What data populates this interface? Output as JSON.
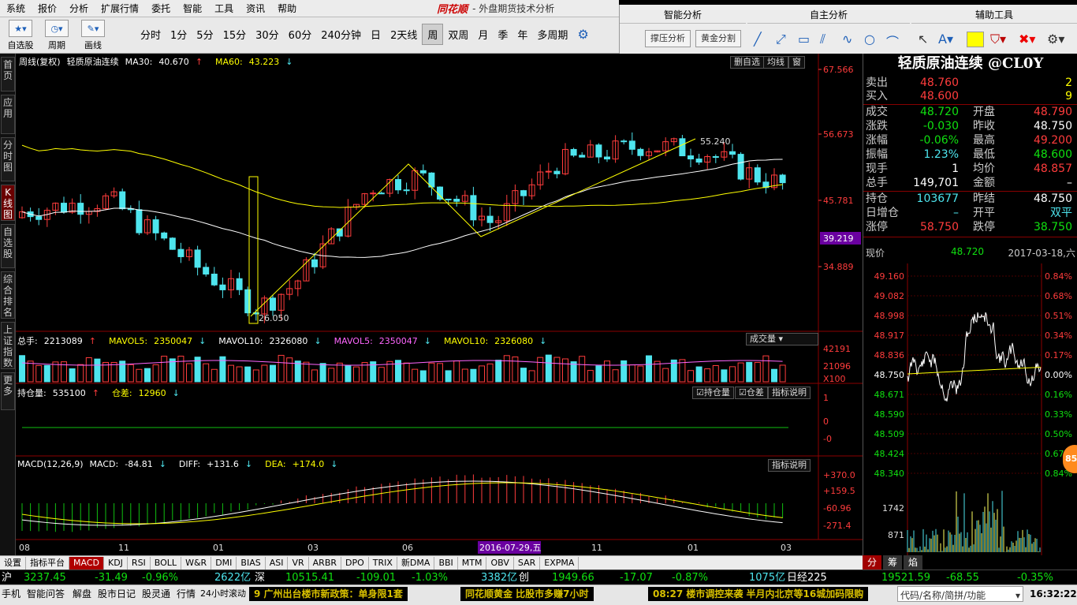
{
  "menu": [
    "系统",
    "报价",
    "分析",
    "扩展行情",
    "委托",
    "智能",
    "工具",
    "资讯",
    "帮助"
  ],
  "brand": "同花顺",
  "app_title": "- 外盘期货技术分析",
  "toolbar": {
    "zixuan": "自选股",
    "zhouqi": "周期",
    "huaxian": "画线"
  },
  "periods": [
    "分时",
    "1分",
    "5分",
    "15分",
    "30分",
    "60分",
    "240分钟",
    "日",
    "2天线",
    "周",
    "双周",
    "月",
    "季",
    "年",
    "多周期"
  ],
  "active_period": "周",
  "right_tools": {
    "tabs": [
      "智能分析",
      "自主分析",
      "辅助工具"
    ],
    "btn_support": "撑压分析",
    "btn_gold": "黄金分割"
  },
  "sidebar_tabs": [
    "首页",
    "应用",
    "分时图",
    "K线图",
    "自选股",
    "综合排名",
    "上证指数",
    "更多"
  ],
  "sidebar_active": "K线图",
  "kline": {
    "legend_prefix": "周线(复权)",
    "symbol_name": "轻质原油连续",
    "ma30_label": "MA30:",
    "ma30_value": "40.670",
    "ma60_label": "MA60:",
    "ma60_value": "43.223",
    "btn_delete": "删自选",
    "btn_ma": "均线",
    "btn_window": "窗",
    "price_ticks": [
      "67.566",
      "56.673",
      "45.781",
      "34.889"
    ],
    "current_price_tag": "39.219",
    "high_label": "55.240",
    "low_label": "26.050",
    "date_tag": "2016-07-29,五",
    "x_ticks": [
      "08",
      "11",
      "01",
      "03",
      "06",
      "11",
      "01",
      "03"
    ]
  },
  "volume": {
    "total_label": "总手:",
    "total_value": "2213089",
    "mavol5_label": "MAVOL5:",
    "mavol5_value": "2350047",
    "mavol10_label": "MAVOL10:",
    "mavol10_value": "2326080",
    "mavol5b_label": "MAVOL5:",
    "mavol5b_value": "2350047",
    "mavol10b_label": "MAVOL10:",
    "mavol10b_value": "2326080",
    "selector": "成交量",
    "ticks": [
      "42191",
      "21096",
      "X100"
    ]
  },
  "position": {
    "label": "持仓量:",
    "value": "535100",
    "diff_label": "仓差:",
    "diff_value": "12960",
    "chk_pos": "持仓量",
    "chk_diff": "仓差",
    "help": "指标说明",
    "ticks": [
      "1",
      "0",
      "-0"
    ]
  },
  "macd": {
    "label": "MACD(12,26,9)",
    "macd_label": "MACD:",
    "macd_value": "-84.81",
    "diff_label": "DIFF:",
    "diff_value": "+131.6",
    "dea_label": "DEA:",
    "dea_value": "+174.0",
    "help": "指标说明",
    "ticks": [
      "+370.0",
      "+159.5",
      "-60.96",
      "-271.4"
    ]
  },
  "bottom_tabs": [
    "设置",
    "指标平台",
    "MACD",
    "KDJ",
    "RSI",
    "BOLL",
    "W&R",
    "DMI",
    "BIAS",
    "ASI",
    "VR",
    "ARBR",
    "DPO",
    "TRIX",
    "新DMA",
    "BBI",
    "MTM",
    "OBV",
    "SAR",
    "EXPMA"
  ],
  "bottom_active": "MACD",
  "quote": {
    "title": "轻质原油连续 @CL0Y",
    "sell_label": "卖出",
    "sell_price": "48.760",
    "sell_qty": "2",
    "buy_label": "买入",
    "buy_price": "48.600",
    "buy_qty": "9",
    "deal_label": "成交",
    "deal": "48.720",
    "open_label": "开盘",
    "open": "48.790",
    "chg_label": "涨跌",
    "chg": "-0.030",
    "prev_label": "昨收",
    "prev": "48.750",
    "chgpct_label": "涨幅",
    "chgpct": "-0.06%",
    "high_label": "最高",
    "high": "49.200",
    "amp_label": "振幅",
    "amp": "1.23%",
    "low_label": "最低",
    "low": "48.600",
    "now_label": "现手",
    "now": "1",
    "avg_label": "均价",
    "avg": "48.857",
    "vol_label": "总手",
    "vol": "149,701",
    "amt_label": "金额",
    "amt": "–",
    "hold_label": "持仓",
    "hold": "103677",
    "prevsettle_label": "昨结",
    "prevsettle": "48.750",
    "daypos_label": "日增仓",
    "daypos": "–",
    "openpos_label": "开平",
    "openpos": "双平",
    "limitup_label": "涨停",
    "limitup": "58.750",
    "limitdown_label": "跌停",
    "limitdown": "38.750",
    "price_label": "现价",
    "price": "48.720",
    "datetime": "2017-03-18,六"
  },
  "intraday": {
    "left_ticks": [
      "49.160",
      "49.082",
      "48.998",
      "48.917",
      "48.836",
      "48.750",
      "48.671",
      "48.590",
      "48.509",
      "48.424",
      "48.340"
    ],
    "right_ticks": [
      "0.84%",
      "0.68%",
      "0.51%",
      "0.34%",
      "0.17%",
      "0.00%",
      "0.16%",
      "0.33%",
      "0.50%",
      "0.67%",
      "0.84%"
    ],
    "vol_ticks": [
      "1742",
      "871"
    ]
  },
  "qp_tabs": [
    "分",
    "筹",
    "焰"
  ],
  "index_bar": {
    "sh_label": "沪",
    "sh_value": "3237.45",
    "sh_chg": "-31.49",
    "sh_pct": "-0.96%",
    "sh_amt": "2622亿",
    "sz_label": "深",
    "sz_value": "10515.41",
    "sz_chg": "-109.01",
    "sz_pct": "-1.03%",
    "sz_amt": "3382亿",
    "cy_label": "创",
    "cy_value": "1949.66",
    "cy_chg": "-17.07",
    "cy_pct": "-0.87%",
    "cy_amt": "1075亿",
    "rj_label": "日经225",
    "rj_value": "19521.59",
    "rj_chg": "-68.55",
    "rj_pct": "-0.35%"
  },
  "status": {
    "items": [
      "手机",
      "智能问答",
      "解盘",
      "股市日记",
      "股灵通",
      "行情"
    ],
    "scroll": "24小时滚动",
    "news1": "9 广州出台楼市新政策：单身限1套",
    "news2": "同花顺黄金 比股市多赚7小时",
    "news3": "08:27 楼市调控来袭  半月内北京等16城加码限购",
    "search_placeholder": "代码/名称/简拼/功能",
    "clock": "16:32:22"
  },
  "badge": "85",
  "colors": {
    "up": "#ff3c3c",
    "down": "#4ee5ee",
    "ma30": "#ffffff",
    "ma60": "#ffff00"
  }
}
